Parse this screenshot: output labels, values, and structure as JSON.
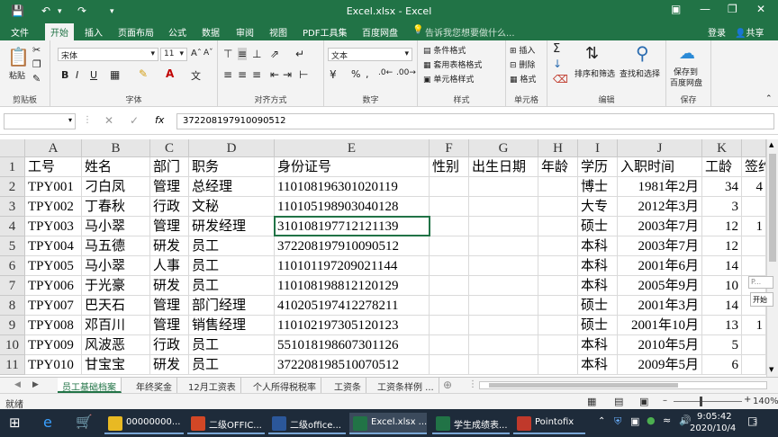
{
  "titlebar": {
    "title": "Excel.xlsx - Excel",
    "save_icon": "save-icon",
    "undo_icon": "undo-icon",
    "redo_icon": "redo-icon",
    "accent": "#217346"
  },
  "tabs": [
    "文件",
    "开始",
    "插入",
    "页面布局",
    "公式",
    "数据",
    "审阅",
    "视图",
    "PDF工具集",
    "百度网盘"
  ],
  "tellme": "告诉我您想要做什么...",
  "account": {
    "login": "登录",
    "share": "共享"
  },
  "ribbon": {
    "paste": "粘贴",
    "clipboard": "剪贴板",
    "font_name": "宋体",
    "font_size": "11",
    "font_group": "字体",
    "bold": "B",
    "italic": "I",
    "underline": "U",
    "align_group": "对齐方式",
    "number_format": "文本",
    "number_group": "数字",
    "cond_format": "条件格式",
    "table_format": "套用表格格式",
    "cell_style": "单元格样式",
    "style_group": "样式",
    "insert": "插入",
    "delete": "删除",
    "format": "格式",
    "cells_group": "单元格",
    "sort_filter": "排序和筛选",
    "find_select": "查找和选择",
    "edit_group": "编辑",
    "save_to": "保存到",
    "baidu": "百度网盘",
    "save_group": "保存"
  },
  "formula": {
    "fx": "fx",
    "value": "372208197910090512"
  },
  "columns": [
    "A",
    "B",
    "C",
    "D",
    "E",
    "F",
    "G",
    "H",
    "I",
    "J",
    "K"
  ],
  "rows": [
    {
      "n": "1",
      "cells": [
        "工号",
        "姓名",
        "部门",
        "职务",
        "身份证号",
        "性别",
        "出生日期",
        "年龄",
        "学历",
        "入职时间",
        "工龄",
        "签约"
      ]
    },
    {
      "n": "2",
      "cells": [
        "TPY001",
        "刁白凤",
        "管理",
        "总经理",
        "110108196301020119",
        "",
        "",
        "",
        "博士",
        "1981年2月",
        "34",
        "4"
      ]
    },
    {
      "n": "3",
      "cells": [
        "TPY002",
        "丁春秋",
        "行政",
        "文秘",
        "110105198903040128",
        "",
        "",
        "",
        "大专",
        "2012年3月",
        "3",
        ""
      ]
    },
    {
      "n": "4",
      "cells": [
        "TPY003",
        "马小翠",
        "管理",
        "研发经理",
        "310108197712121139",
        "",
        "",
        "",
        "硕士",
        "2003年7月",
        "12",
        "1"
      ]
    },
    {
      "n": "5",
      "cells": [
        "TPY004",
        "马五德",
        "研发",
        "员工",
        "372208197910090512",
        "",
        "",
        "",
        "本科",
        "2003年7月",
        "12",
        ""
      ]
    },
    {
      "n": "6",
      "cells": [
        "TPY005",
        "马小翠",
        "人事",
        "员工",
        "110101197209021144",
        "",
        "",
        "",
        "本科",
        "2001年6月",
        "14",
        ""
      ]
    },
    {
      "n": "7",
      "cells": [
        "TPY006",
        "于光豪",
        "研发",
        "员工",
        "110108198812120129",
        "",
        "",
        "",
        "本科",
        "2005年9月",
        "10",
        ""
      ]
    },
    {
      "n": "8",
      "cells": [
        "TPY007",
        "巴天石",
        "管理",
        "部门经理",
        "410205197412278211",
        "",
        "",
        "",
        "硕士",
        "2001年3月",
        "14",
        ""
      ]
    },
    {
      "n": "9",
      "cells": [
        "TPY008",
        "邓百川",
        "管理",
        "销售经理",
        "110102197305120123",
        "",
        "",
        "",
        "硕士",
        "2001年10月",
        "13",
        "1"
      ]
    },
    {
      "n": "10",
      "cells": [
        "TPY009",
        "风波恶",
        "行政",
        "员工",
        "551018198607301126",
        "",
        "",
        "",
        "本科",
        "2010年5月",
        "5",
        ""
      ]
    },
    {
      "n": "11",
      "cells": [
        "TPY010",
        "甘宝宝",
        "研发",
        "员工",
        "372208198510070512",
        "",
        "",
        "",
        "本科",
        "2009年5月",
        "6",
        ""
      ]
    }
  ],
  "sheets": [
    "员工基础档案",
    "年终奖金",
    "12月工资表",
    "个人所得税税率",
    "工资条",
    "工资条样例 ..."
  ],
  "status": {
    "ready": "就绪",
    "zoom": "140%"
  },
  "side_popup": "P...",
  "side_button": "开始",
  "taskbar": {
    "items": [
      {
        "label": "00000000...",
        "color": "#e8b923"
      },
      {
        "label": "二级OFFIC...",
        "color": "#d24726"
      },
      {
        "label": "二级office...",
        "color": "#2b579a"
      },
      {
        "label": "Excel.xlsx ...",
        "color": "#217346"
      },
      {
        "label": "学生成绩表...",
        "color": "#217346"
      },
      {
        "label": "Pointofix",
        "color": "#c0392b"
      }
    ],
    "time": "9:05:42",
    "date": "2020/10/4",
    "notif_count": "3"
  }
}
